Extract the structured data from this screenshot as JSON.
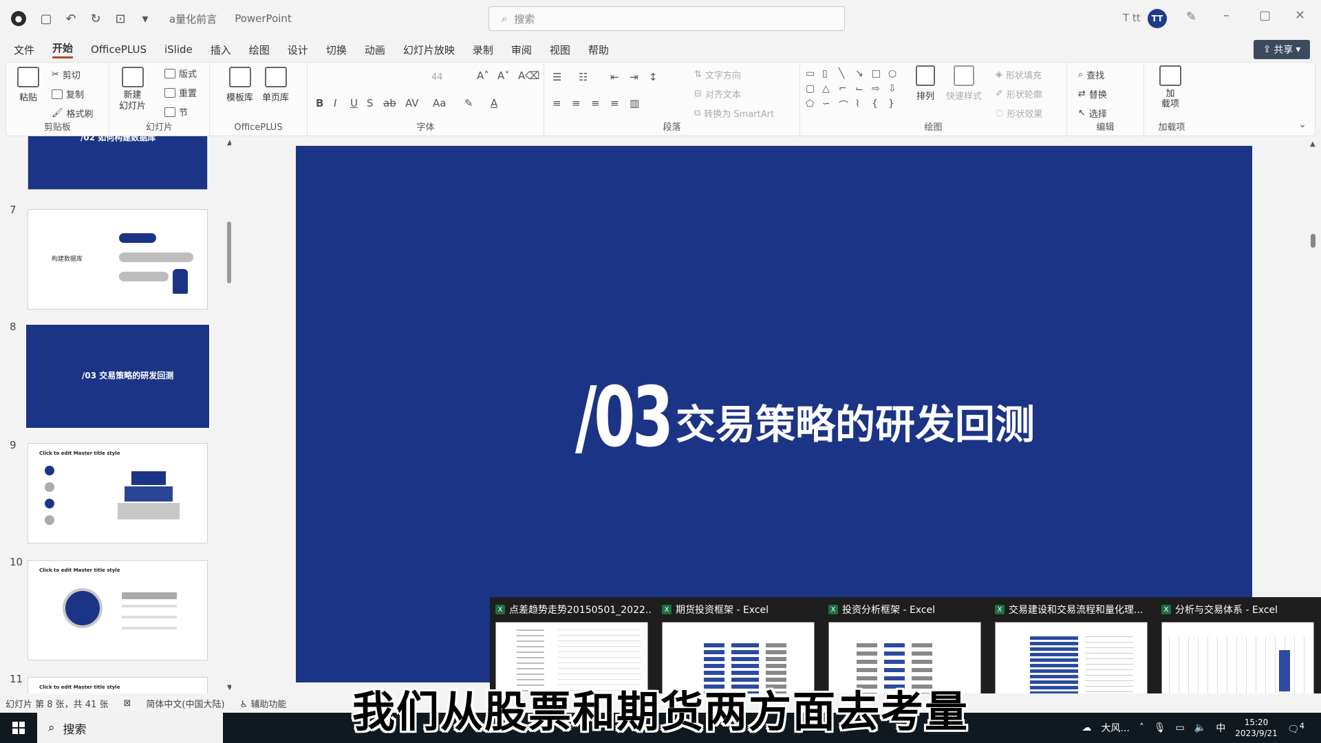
{
  "titlebar": {
    "doc_title": "a量化前言",
    "app_title": "PowerPoint",
    "search_placeholder": "搜索",
    "user_name": "T tt",
    "avatar_initials": "TT"
  },
  "menu": {
    "tabs": [
      "文件",
      "开始",
      "OfficePLUS",
      "iSlide",
      "插入",
      "绘图",
      "设计",
      "切换",
      "动画",
      "幻灯片放映",
      "录制",
      "审阅",
      "视图",
      "帮助"
    ],
    "active_index": 1,
    "share_label": "共享"
  },
  "ribbon": {
    "clipboard": {
      "label": "剪贴板",
      "paste": "粘贴",
      "cut": "剪切",
      "copy": "复制",
      "format_painter": "格式刷"
    },
    "slides": {
      "label": "幻灯片",
      "new_slide": "新建\n幻灯片",
      "layout": "版式",
      "reset": "重置",
      "section": "节"
    },
    "officeplus": {
      "label": "OfficePLUS",
      "template_lib": "模板库",
      "single_page_lib": "单页库"
    },
    "font": {
      "label": "字体",
      "size": "44"
    },
    "paragraph": {
      "label": "段落",
      "text_direction": "文字方向",
      "align_text": "对齐文本",
      "smartart": "转换为 SmartArt"
    },
    "drawing": {
      "label": "绘图",
      "arrange": "排列",
      "quick_styles": "快速样式",
      "shape_fill": "形状填充",
      "shape_outline": "形状轮廓",
      "shape_effects": "形状效果"
    },
    "editing": {
      "label": "编辑",
      "find": "查找",
      "replace": "替换",
      "select": "选择"
    },
    "addins": {
      "label": "加载项",
      "addin_btn": "加\n载项"
    }
  },
  "thumbnails": {
    "items": [
      {
        "number": "",
        "title": "/02 如何构建数据库",
        "variant": "blue"
      },
      {
        "number": "7",
        "title": "构建数据库",
        "variant": "white"
      },
      {
        "number": "8",
        "title": "/03 交易策略的研发回测",
        "variant": "blue-selected"
      },
      {
        "number": "9",
        "title": "Click to edit Master title style",
        "variant": "white"
      },
      {
        "number": "10",
        "title": "Click to edit Master title style",
        "variant": "white"
      },
      {
        "number": "11",
        "title": "Click to edit Master title style",
        "variant": "white"
      }
    ]
  },
  "slide": {
    "number": "/03",
    "title": "交易策略的研发回测",
    "background": "#1b3485"
  },
  "previews": [
    {
      "title": "点差趋势走势20150501_2022..."
    },
    {
      "title": "期货投资框架 - Excel"
    },
    {
      "title": "投资分析框架 - Excel"
    },
    {
      "title": "交易建设和交易流程和量化理..."
    },
    {
      "title": "分析与交易体系 - Excel"
    }
  ],
  "statusbar": {
    "slide_info": "幻灯片 第 8 张，共 41 张",
    "language": "简体中文(中国大陆)",
    "accessibility": "辅助功能"
  },
  "taskbar": {
    "search_label": "搜索",
    "weather": "大风...",
    "ime": "中",
    "time": "15:20",
    "date": "2023/9/21",
    "notifications": "4"
  },
  "subtitle": "我们从股票和期货两方面去考量"
}
